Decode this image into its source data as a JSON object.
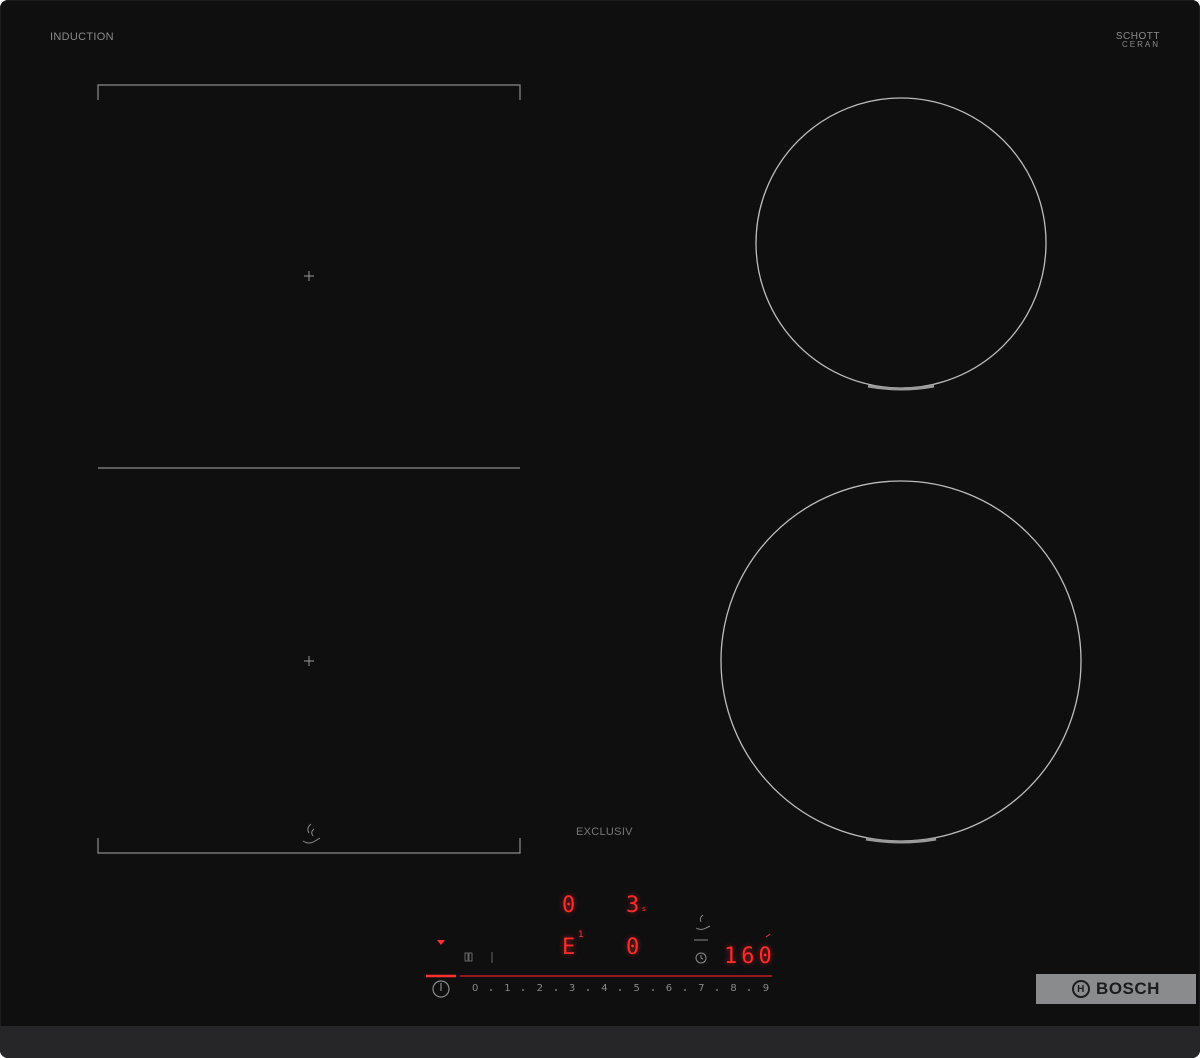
{
  "labels": {
    "induction": "INDUCTION",
    "schott_line1": "SCHOTT",
    "schott_line2": "CERAN",
    "exclusiv": "EXCLUSIV",
    "brand": "BOSCH"
  },
  "displays": {
    "top_left": "0",
    "top_right": "3",
    "top_right_suffix": "s",
    "mid_left": "E",
    "mid_left_sup": "1",
    "mid_center": "0",
    "timer": "160"
  },
  "power_scale": [
    "0",
    "1",
    "2",
    "3",
    "4",
    "5",
    "6",
    "7",
    "8",
    "9"
  ],
  "icons": {
    "power": "power-icon",
    "wifi": "wifi-icon",
    "pan": "pan-icon",
    "timer": "timer-icon",
    "brand_logo": "bosch-logo-icon"
  },
  "colors": {
    "glass": "#0f0f10",
    "display_red": "#ff2a2a",
    "badge": "#8a8b8d"
  }
}
